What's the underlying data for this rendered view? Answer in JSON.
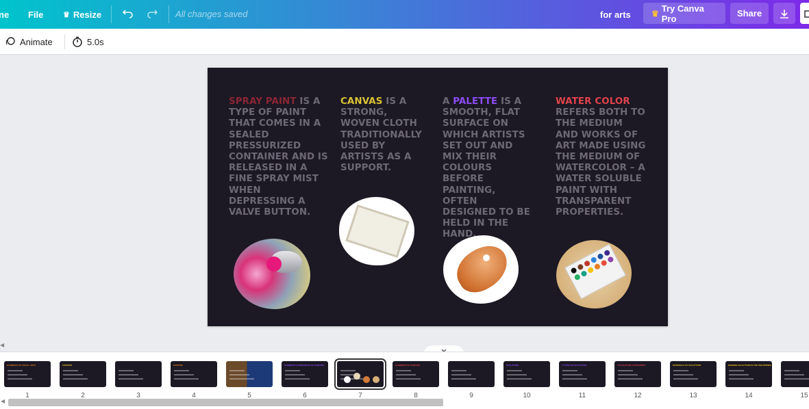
{
  "topbar": {
    "home_label": "ne",
    "file_label": "File",
    "resize_label": "Resize",
    "save_status": "All changes saved",
    "doc_title": "for arts",
    "pro_label": "Try Canva Pro",
    "share_label": "Share"
  },
  "toolbar": {
    "animate_label": "Animate",
    "duration": "5.0s"
  },
  "slide": {
    "columns": [
      {
        "highlight": "SPRAY PAINT",
        "highlight_color": "#8b2635",
        "body": "IS A TYPE OF PAINT THAT COMES IN A SEALED PRESSURIZED CONTAINER AND IS RELEASED IN A FINE SPRAY MIST WHEN DEPRESSING A VALVE BUTTON."
      },
      {
        "highlight": "CANVAS",
        "highlight_color": "#d9c234",
        "body": "IS A STRONG, WOVEN CLOTH TRADITIONALLY USED BY ARTISTS AS A SUPPORT."
      },
      {
        "prefix": "A",
        "highlight": "PALETTE",
        "highlight_color": "#8b4cf5",
        "body": "IS A SMOOTH, FLAT SURFACE ON WHICH ARTISTS SET OUT AND MIX THEIR COLOURS BEFORE PAINTING, OFTEN DESIGNED TO BE HELD IN THE HAND."
      },
      {
        "highlight": "WATER COLOR",
        "highlight_color": "#e0434b",
        "body": "REFERS BOTH TO THE MEDIUM AND WORKS OF ART MADE USING THE MEDIUM OF WATERCOLOR – A WATER SOLUBLE PAINT WITH TRANSPARENT PROPERTIES."
      }
    ]
  },
  "pages": {
    "active": 7,
    "numbers": [
      "1",
      "2",
      "3",
      "4",
      "5",
      "6",
      "7",
      "8",
      "9",
      "10",
      "11",
      "12",
      "13",
      "14",
      "15"
    ],
    "thumb_titles": [
      "ELEMENTS OF VISUAL ARTS",
      "CONTENT",
      "",
      "PAINTING",
      "",
      "ELEMENTS & PRINCIPLES OF PAINTING",
      "",
      "ELEMENTS OF PAINTING",
      "",
      "SCULPTURE",
      "3 TYPES OF SCULPTURE",
      "5 SCULPTURE CATEGORIES",
      "MATERIALS OF SCULPTURE",
      "MODERN SCULPTURE IN THE PHILIPPINES",
      ""
    ]
  }
}
